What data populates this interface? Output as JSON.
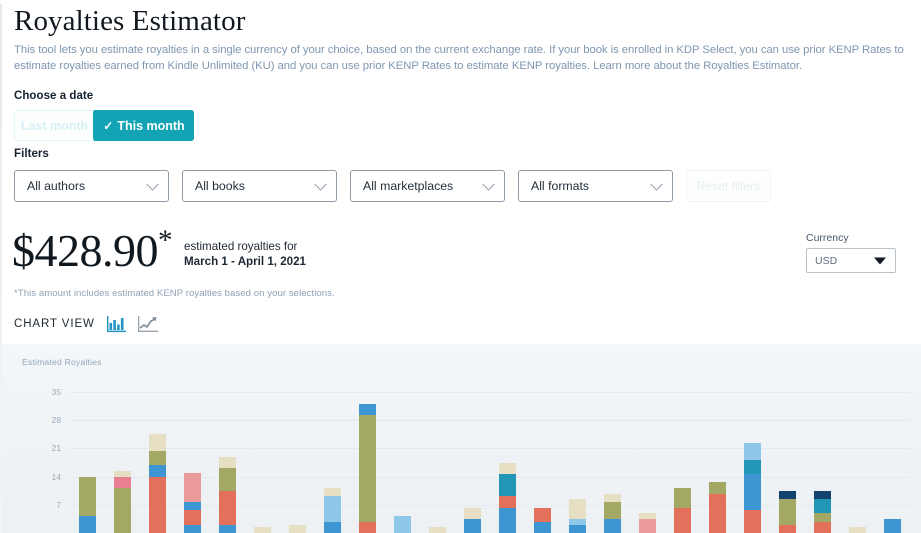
{
  "header": {
    "title": "Royalties Estimator",
    "intro_line1": "This tool lets you estimate royalties in a single currency of your choice, based on the current exchange rate. If your book is enrolled in KDP Select, you can use prior KENP Rates to estimate royalties",
    "intro_line2": "earned from Kindle Unlimited (KU) and you can use prior KENP Rates to estimate KENP royalties.",
    "learn_more": "Learn more about the Royalties Estimator."
  },
  "date": {
    "label": "Choose a date",
    "last_month": "Last month",
    "this_month": "This month",
    "check": "✓"
  },
  "filters": {
    "label": "Filters",
    "authors": "All authors",
    "books": "All books",
    "marketplaces": "All marketplaces",
    "formats": "All formats",
    "reset": "Reset filters"
  },
  "summary": {
    "amount": "$428.90",
    "asterisk": "*",
    "meta_line1": "estimated royalties for",
    "meta_line2": "March 1 - April 1, 2021",
    "footnote": "*This amount includes estimated KENP royalties based on your selections."
  },
  "currency": {
    "label": "Currency",
    "value": "USD"
  },
  "chart_view": {
    "label": "CHART VIEW",
    "bar_icon": "bar-chart-icon",
    "line_icon": "line-chart-icon",
    "selected": "bar"
  },
  "chart_data": {
    "type": "bar",
    "title": "Estimated Royalties",
    "xlabel": "",
    "ylabel": "",
    "ylim": [
      0,
      38
    ],
    "yticks": [
      7,
      14,
      21,
      28,
      35
    ],
    "ytick_labels": [
      "7",
      "14",
      "21",
      "28",
      "35"
    ],
    "grid": true,
    "stacked": true,
    "legend": "none",
    "series_colors": {
      "blue": "#3d96d1",
      "light_blue": "#8fc7e8",
      "teal": "#2196b5",
      "navy": "#12436e",
      "olive": "#a3a865",
      "cream": "#e6dfc4",
      "salmon": "#e2705a",
      "pink": "#eb9a9a",
      "rose": "#e87f93"
    },
    "bars": [
      {
        "x": 1,
        "total": 14.0,
        "segments": [
          {
            "color": "blue",
            "value": 4.2
          },
          {
            "color": "olive",
            "value": 9.8
          }
        ]
      },
      {
        "x": 2,
        "total": 15.4,
        "segments": [
          {
            "color": "olive",
            "value": 11.2
          },
          {
            "color": "rose",
            "value": 2.8
          },
          {
            "color": "cream",
            "value": 1.4
          }
        ]
      },
      {
        "x": 3,
        "total": 24.5,
        "segments": [
          {
            "color": "salmon",
            "value": 14.0
          },
          {
            "color": "blue",
            "value": 2.8
          },
          {
            "color": "olive",
            "value": 3.5
          },
          {
            "color": "cream",
            "value": 4.2
          }
        ]
      },
      {
        "x": 4,
        "total": 15.0,
        "segments": [
          {
            "color": "blue",
            "value": 2.1
          },
          {
            "color": "salmon",
            "value": 3.5
          },
          {
            "color": "blue",
            "value": 2.1
          },
          {
            "color": "pink",
            "value": 7.3
          }
        ]
      },
      {
        "x": 5,
        "total": 18.9,
        "segments": [
          {
            "color": "blue",
            "value": 2.1
          },
          {
            "color": "salmon",
            "value": 8.4
          },
          {
            "color": "olive",
            "value": 5.6
          },
          {
            "color": "cream",
            "value": 2.8
          }
        ]
      },
      {
        "x": 6,
        "total": 1.4,
        "segments": [
          {
            "color": "cream",
            "value": 1.4
          }
        ]
      },
      {
        "x": 7,
        "total": 2.1,
        "segments": [
          {
            "color": "cream",
            "value": 2.1
          }
        ]
      },
      {
        "x": 8,
        "total": 11.2,
        "segments": [
          {
            "color": "blue",
            "value": 2.8
          },
          {
            "color": "light_blue",
            "value": 6.3
          },
          {
            "color": "cream",
            "value": 2.1
          }
        ]
      },
      {
        "x": 9,
        "total": 32.0,
        "segments": [
          {
            "color": "salmon",
            "value": 2.8
          },
          {
            "color": "olive",
            "value": 26.6
          },
          {
            "color": "blue",
            "value": 2.6
          }
        ]
      },
      {
        "x": 10,
        "total": 4.2,
        "segments": [
          {
            "color": "light_blue",
            "value": 4.2
          }
        ]
      },
      {
        "x": 11,
        "total": 1.4,
        "segments": [
          {
            "color": "cream",
            "value": 1.4
          }
        ]
      },
      {
        "x": 12,
        "total": 6.3,
        "segments": [
          {
            "color": "blue",
            "value": 3.5
          },
          {
            "color": "cream",
            "value": 2.8
          }
        ]
      },
      {
        "x": 13,
        "total": 17.5,
        "segments": [
          {
            "color": "blue",
            "value": 6.3
          },
          {
            "color": "salmon",
            "value": 2.8
          },
          {
            "color": "teal",
            "value": 5.6
          },
          {
            "color": "cream",
            "value": 2.8
          }
        ]
      },
      {
        "x": 14,
        "total": 6.3,
        "segments": [
          {
            "color": "blue",
            "value": 2.8
          },
          {
            "color": "salmon",
            "value": 3.5
          }
        ]
      },
      {
        "x": 15,
        "total": 8.4,
        "segments": [
          {
            "color": "blue",
            "value": 2.1
          },
          {
            "color": "light_blue",
            "value": 1.4
          },
          {
            "color": "cream",
            "value": 4.9
          }
        ]
      },
      {
        "x": 16,
        "total": 9.8,
        "segments": [
          {
            "color": "blue",
            "value": 3.5
          },
          {
            "color": "olive",
            "value": 4.2
          },
          {
            "color": "cream",
            "value": 2.1
          }
        ]
      },
      {
        "x": 17,
        "total": 4.9,
        "segments": [
          {
            "color": "pink",
            "value": 3.5
          },
          {
            "color": "cream",
            "value": 1.4
          }
        ]
      },
      {
        "x": 18,
        "total": 11.2,
        "segments": [
          {
            "color": "salmon",
            "value": 6.3
          },
          {
            "color": "olive",
            "value": 4.9
          }
        ]
      },
      {
        "x": 19,
        "total": 12.6,
        "segments": [
          {
            "color": "salmon",
            "value": 9.8
          },
          {
            "color": "olive",
            "value": 2.8
          }
        ]
      },
      {
        "x": 20,
        "total": 22.4,
        "segments": [
          {
            "color": "salmon",
            "value": 5.6
          },
          {
            "color": "blue",
            "value": 9.1
          },
          {
            "color": "teal",
            "value": 3.5
          },
          {
            "color": "light_blue",
            "value": 4.2
          }
        ]
      },
      {
        "x": 21,
        "total": 10.5,
        "segments": [
          {
            "color": "salmon",
            "value": 2.1
          },
          {
            "color": "olive",
            "value": 6.3
          },
          {
            "color": "navy",
            "value": 2.1
          }
        ]
      },
      {
        "x": 22,
        "total": 10.5,
        "segments": [
          {
            "color": "salmon",
            "value": 2.8
          },
          {
            "color": "olive",
            "value": 2.1
          },
          {
            "color": "teal",
            "value": 3.5
          },
          {
            "color": "navy",
            "value": 2.1
          }
        ]
      },
      {
        "x": 23,
        "total": 1.4,
        "segments": [
          {
            "color": "cream",
            "value": 1.4
          }
        ]
      },
      {
        "x": 24,
        "total": 3.5,
        "segments": [
          {
            "color": "blue",
            "value": 3.5
          }
        ]
      }
    ]
  }
}
